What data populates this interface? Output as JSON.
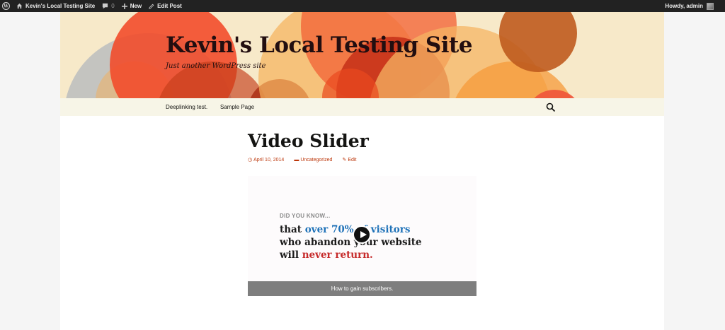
{
  "adminbar": {
    "site_name": "Kevin's Local Testing Site",
    "comments_count": "0",
    "new_label": "New",
    "edit_label": "Edit Post",
    "howdy": "Howdy, admin"
  },
  "header": {
    "title": "Kevin's Local Testing Site",
    "description": "Just another WordPress site"
  },
  "nav": {
    "items": [
      "Deeplinking test.",
      "Sample Page"
    ]
  },
  "post": {
    "title": "Video Slider",
    "date": "April 10, 2014",
    "category": "Uncategorized",
    "edit": "Edit"
  },
  "slider": {
    "kicker": "DID YOU KNOW...",
    "line1_a": "that ",
    "line1_b": "over 70% of visitors",
    "line2": "who abandon your website",
    "line3_a": "will ",
    "line3_b": "never return.",
    "caption": "How to gain subscribers."
  },
  "colors": {
    "adminbar": "#222222",
    "header_bg": "#f7e9c9",
    "nav_bg": "#f7f5e7",
    "accent": "#bc360a",
    "blue": "#1f72b8",
    "red": "#c62b2b"
  }
}
